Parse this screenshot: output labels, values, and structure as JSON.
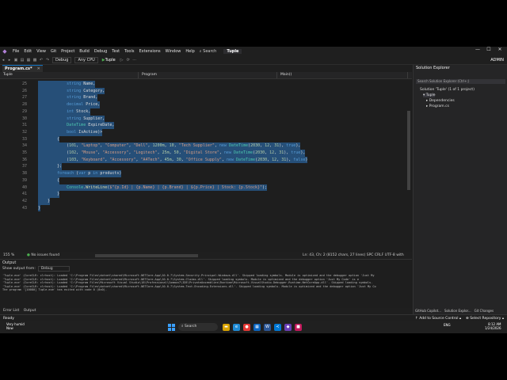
{
  "app": {
    "menu": [
      "File",
      "Edit",
      "View",
      "Git",
      "Project",
      "Build",
      "Debug",
      "Test",
      "Tools",
      "Extensions",
      "Window",
      "Help"
    ],
    "search_label": "Search",
    "title": "Tuple",
    "window_controls": [
      "—",
      "☐",
      "✕"
    ]
  },
  "toolbar": {
    "config": "Debug",
    "platform": "Any CPU",
    "run_target": "Tuple",
    "account": "ADMIN"
  },
  "tab": {
    "name": "Program.cs*",
    "close": "✕"
  },
  "navbar": {
    "project": "Tuple",
    "class": "Program",
    "member": "Main()"
  },
  "code": [
    {
      "n": "25",
      "t": "            string Name,"
    },
    {
      "n": "26",
      "t": "            string Category,"
    },
    {
      "n": "27",
      "t": "            string Brand,"
    },
    {
      "n": "28",
      "t": "            decimal Price,"
    },
    {
      "n": "29",
      "t": "            int Stock,"
    },
    {
      "n": "30",
      "t": "            string Supplier,"
    },
    {
      "n": "31",
      "t": "            DateTime ExpireDate,"
    },
    {
      "n": "32",
      "t": "            bool IsActive)>"
    },
    {
      "n": "33",
      "t": "        {"
    },
    {
      "n": "34",
      "t": "            (101, \"Laptop\", \"Computer\", \"Dell\", 1200m, 10, \"Tech Supplier\", new DateTime(2030, 12, 31), true),"
    },
    {
      "n": "35",
      "t": "            (102, \"Mouse\", \"Accessory\", \"Logitech\", 25m, 50, \"Digital Store\", new DateTime(2030, 12, 31), true),"
    },
    {
      "n": "36",
      "t": "            (103, \"Keyboard\", \"Accessory\", \"A4Tech\", 45m, 30, \"Office Supply\", new DateTime(2030, 12, 31), false)"
    },
    {
      "n": "37",
      "t": "        };"
    },
    {
      "n": "38",
      "t": "        foreach (var p in products)"
    },
    {
      "n": "39",
      "t": "        {"
    },
    {
      "n": "40",
      "t": "            Console.WriteLine($\"{p.Id} | {p.Name} | {p.Brand} | ${p.Price} | Stock: {p.Stock}\");"
    },
    {
      "n": "41",
      "t": "        }"
    },
    {
      "n": "42",
      "t": "    }"
    },
    {
      "n": "43",
      "t": "}"
    }
  ],
  "status": {
    "zoom": "155 %",
    "issues": "No issues found",
    "cursor": "Ln: 43, Ch: 2    (8152 chars, 27 lines)    SPC    CRLF    UTF-8 with BOM"
  },
  "output": {
    "title": "Output",
    "source_label": "Show output from:",
    "source": "Debug",
    "lines": [
      "'Tuple.exe' (CoreCLR: clrhost): Loaded 'C:\\Program Files\\dotnet\\shared\\Microsoft.NETCore.App\\10.0.7\\System.Security.Principal.Windows.dll'. Skipped loading symbols. Module is optimized and the debugger option 'Just My",
      "'Tuple.exe' (CoreCLR: clrhost): Loaded 'C:\\Program Files\\dotnet\\shared\\Microsoft.NETCore.App\\10.0.7\\System.Claims.dll'. Skipped loading symbols. Module is optimized and the debugger option 'Just My Code' is e",
      "'Tuple.exe' (CoreCLR: clrhost): Loaded 'C:\\Program Files\\Microsoft Visual Studio\\18\\Professional\\Common7\\IDE\\PrivateAssemblies\\Runtime\\Microsoft.VisualStudio.Debugger.Runtime.NetCoreApp.dll'. Skipped loading symbols.",
      "'Tuple.exe' (CoreCLR: clrhost): Loaded 'C:\\Program Files\\dotnet\\shared\\Microsoft.NETCore.App\\10.0.7\\System.Text.Encoding.Extensions.dll'. Skipped loading symbols. Module is optimized and the debugger option 'Just My Co",
      "The program '[10080] Tuple.exe' has exited with code 0 (0x0)."
    ]
  },
  "bottom_tabs": [
    "Error List",
    "Output"
  ],
  "statusbar": {
    "ready": "Ready",
    "source_control": "↑ Add to Source Control ▴",
    "repo": "⊕ Select Repository ▴"
  },
  "solution_explorer": {
    "title": "Solution Explorer",
    "search": "Search Solution Explorer (Ctrl+;)",
    "items": [
      {
        "label": "Solution 'Tuple' (1 of 1 project)"
      },
      {
        "label": "▾ Tuple"
      },
      {
        "label": "▸ Dependencies"
      },
      {
        "label": "▸ Program.cs"
      }
    ],
    "tabs": [
      "GitHub Copilot...",
      "Solution Explor...",
      "Git Changes"
    ]
  },
  "taskbar": {
    "weather_line1": "Very humid",
    "weather_line2": "Now",
    "search": "Search",
    "time": "8:12 AM",
    "date": "1/24/2026",
    "tray": "ENG"
  },
  "colors": {
    "selection": "#264f78",
    "keyword": "#569cd6",
    "type": "#4ec9b0",
    "string": "#d69d85"
  }
}
